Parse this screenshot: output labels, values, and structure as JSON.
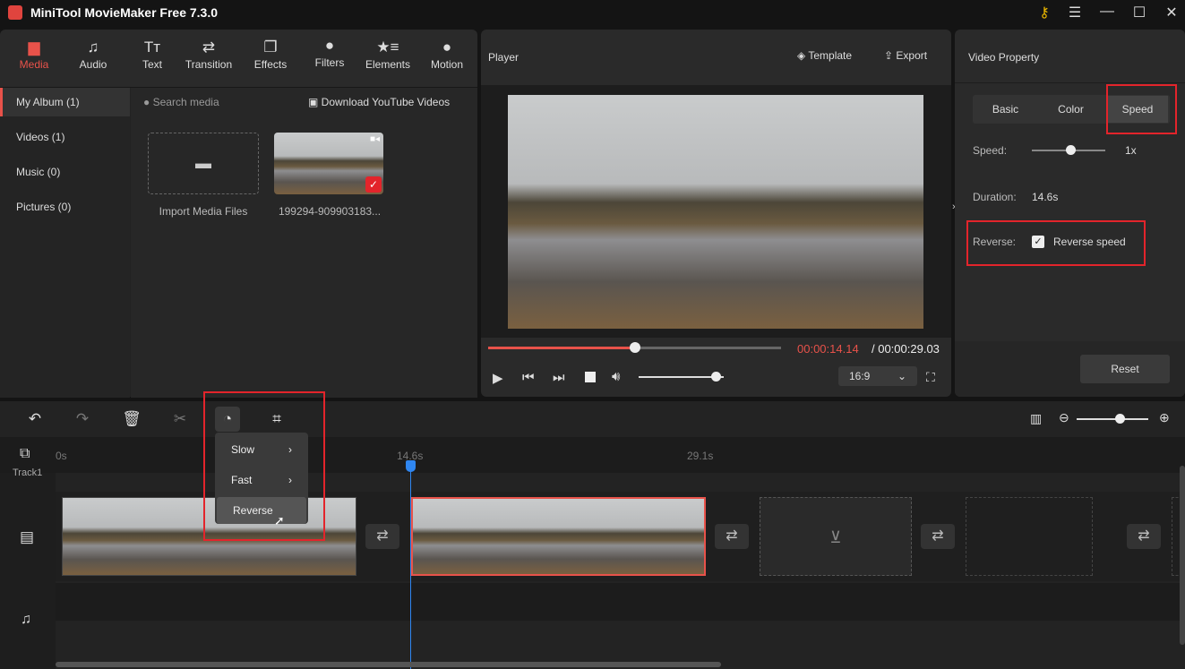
{
  "app": {
    "title": "MiniTool MovieMaker Free 7.3.0"
  },
  "toolbar_tabs": [
    {
      "label": "Media",
      "icon": "folder-icon"
    },
    {
      "label": "Audio",
      "icon": "music-icon"
    },
    {
      "label": "Text",
      "icon": "text-icon"
    },
    {
      "label": "Transition",
      "icon": "transition-icon"
    },
    {
      "label": "Effects",
      "icon": "effects-icon"
    },
    {
      "label": "Filters",
      "icon": "filters-icon"
    },
    {
      "label": "Elements",
      "icon": "elements-icon"
    },
    {
      "label": "Motion",
      "icon": "motion-icon"
    }
  ],
  "sidebar": {
    "items": [
      {
        "label": "My Album (1)"
      },
      {
        "label": "Videos (1)"
      },
      {
        "label": "Music (0)"
      },
      {
        "label": "Pictures (0)"
      }
    ]
  },
  "media": {
    "search_placeholder": "Search media",
    "download_label": "Download YouTube Videos",
    "import_label": "Import Media Files",
    "clip_name": "199294-909903183..."
  },
  "player": {
    "title": "Player",
    "template_label": "Template",
    "export_label": "Export",
    "current_time": "00:00:14.14",
    "total_time": "/ 00:00:29.03",
    "progress": 0.5,
    "volume": 0.9,
    "aspect": "16:9"
  },
  "property": {
    "title": "Video Property",
    "tabs": [
      "Basic",
      "Color",
      "Speed"
    ],
    "active_tab": "Speed",
    "speed_label": "Speed:",
    "speed_value": "1x",
    "duration_label": "Duration:",
    "duration_value": "14.6s",
    "reverse_label": "Reverse:",
    "reverse_checkbox": "Reverse speed",
    "reverse_checked": true,
    "reset_label": "Reset"
  },
  "timeline": {
    "ruler": [
      "0s",
      "14.6s",
      "29.1s"
    ],
    "track_label": "Track1",
    "speed_menu": [
      {
        "label": "Slow",
        "submenu": true
      },
      {
        "label": "Fast",
        "submenu": true
      },
      {
        "label": "Reverse",
        "submenu": false
      }
    ],
    "zoom_level": 0.6
  }
}
